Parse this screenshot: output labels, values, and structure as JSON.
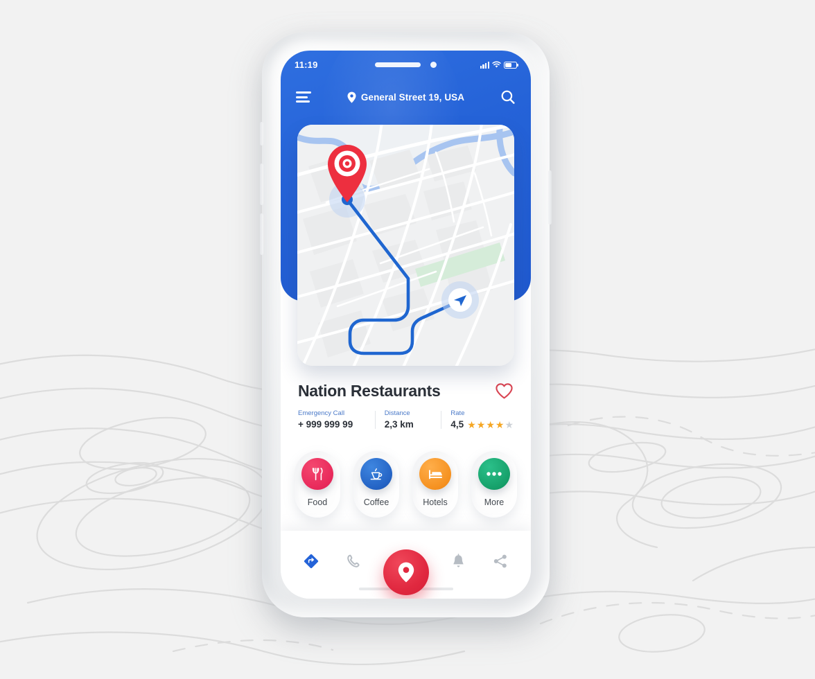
{
  "status_bar": {
    "time": "11:19",
    "signal_icon": "signal-bars-icon",
    "wifi_icon": "wifi-icon",
    "battery_icon": "battery-icon"
  },
  "app_bar": {
    "menu_icon": "hamburger-menu-icon",
    "location_pin_icon": "location-pin-icon",
    "address": "General Street 19, USA",
    "search_icon": "search-icon"
  },
  "map": {
    "origin_marker_icon": "red-map-pin-icon",
    "destination_marker_icon": "navigation-arrow-icon",
    "route_color": "#1f66d0",
    "water_color": "#a7c4f0",
    "park_color": "#d5ecd9",
    "land_color": "#f0f1f2",
    "road_color": "#ffffff"
  },
  "place": {
    "title": "Nation Restaurants",
    "favorite_icon": "heart-outline-icon",
    "stats": [
      {
        "label": "Emergency Call",
        "value": "+ 999 999 99"
      },
      {
        "label": "Distance",
        "value": "2,3 km"
      },
      {
        "label": "Rate",
        "value": "4,5"
      }
    ],
    "rating": {
      "value": "4,5",
      "stars_filled": 4,
      "stars_total": 5,
      "star_color": "#f5a623",
      "star_empty_color": "#ccd1d6"
    }
  },
  "categories": [
    {
      "label": "Food",
      "icon": "fork-knife-icon",
      "color": "#e8295b"
    },
    {
      "label": "Coffee",
      "icon": "coffee-cup-icon",
      "color": "#2463c4"
    },
    {
      "label": "Hotels",
      "icon": "bed-icon",
      "color": "#f59120"
    },
    {
      "label": "More",
      "icon": "ellipsis-icon",
      "color": "#16a06a"
    }
  ],
  "bottom_nav": [
    {
      "name": "directions",
      "icon": "navigation-diamond-icon"
    },
    {
      "name": "call",
      "icon": "phone-icon"
    },
    {
      "name": "locate",
      "icon": "map-pin-icon"
    },
    {
      "name": "alerts",
      "icon": "bell-icon"
    },
    {
      "name": "share",
      "icon": "share-icon"
    }
  ],
  "theme": {
    "primary_blue": "#2563d8",
    "accent_red": "#e0283f",
    "label_blue": "#4a79c8",
    "text_dark": "#2b3038"
  }
}
